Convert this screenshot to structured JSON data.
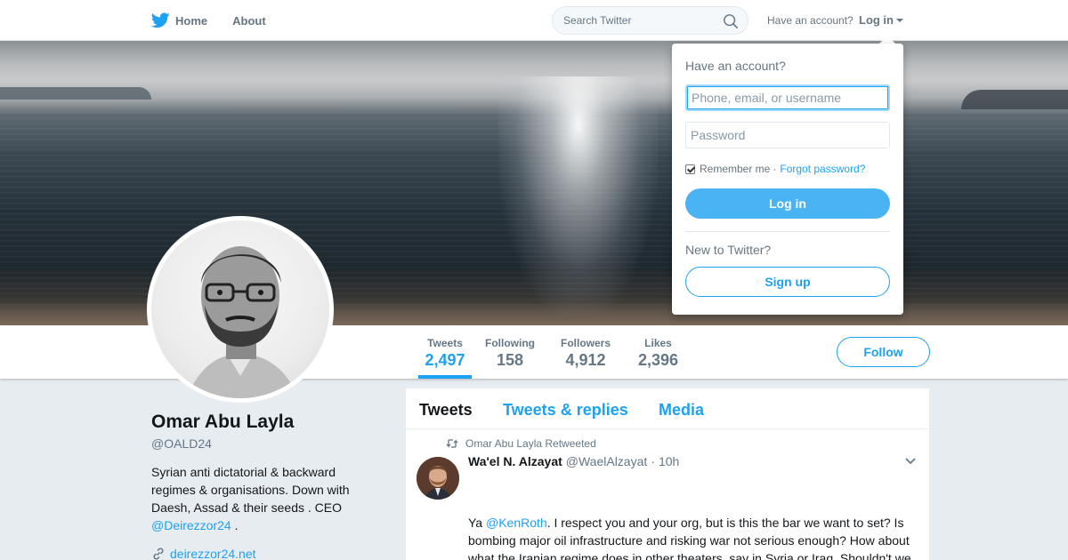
{
  "nav": {
    "home_label": "Home",
    "about_label": "About",
    "search_placeholder": "Search Twitter",
    "have_account": "Have an account?",
    "login_label": "Log in",
    "brand_color": "#1da1f2"
  },
  "profile": {
    "name": "Omar Abu Layla",
    "handle": "@OALD24",
    "bio_text": "Syrian anti dictatorial & backward regimes & organisations. Down with Daesh, Assad & their seeds . CEO ",
    "bio_mention": "@Deirezzor24",
    "bio_end": " .",
    "website": "deirezzor24.net"
  },
  "stats": [
    {
      "label": "Tweets",
      "value": "2,497",
      "active": true
    },
    {
      "label": "Following",
      "value": "158",
      "active": false
    },
    {
      "label": "Followers",
      "value": "4,912",
      "active": false
    },
    {
      "label": "Likes",
      "value": "2,396",
      "active": false
    }
  ],
  "follow_label": "Follow",
  "timeline": {
    "tabs": [
      "Tweets",
      "Tweets & replies",
      "Media"
    ],
    "active_tab": "Tweets",
    "tweet": {
      "retweet_context": "Omar Abu Layla Retweeted",
      "author_name": "Wa'el N. Alzayat",
      "author_handle": "@WaelAlzayat",
      "separator": "·",
      "time": "10h",
      "text_pre": "Ya ",
      "mention": "@KenRoth",
      "text_post": ". I respect you and your org, but is this the bar we want to set? Is bombing major oil infrastructure and risking war not serious enough? How about what the Iranian regime does in other theaters, say in Syria or Iraq. Shouldn't we look at the entire chessboard?"
    }
  },
  "login_dropdown": {
    "title": "Have an account?",
    "username_placeholder": "Phone, email, or username",
    "password_placeholder": "Password",
    "remember_label": "Remember me",
    "separator": "·",
    "forgot_label": "Forgot password?",
    "login_button": "Log in",
    "new_label": "New to Twitter?",
    "signup_button": "Sign up"
  }
}
